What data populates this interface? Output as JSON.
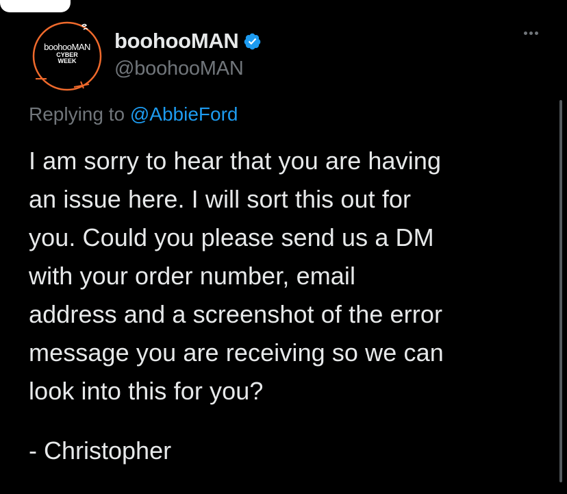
{
  "tweet": {
    "avatar": {
      "brand": "boohooMAN",
      "tagline_line1": "CYBER",
      "tagline_line2": "WEEK",
      "ring_color": "#f06a2c"
    },
    "display_name": "boohooMAN",
    "verified_icon": "verified-badge-icon",
    "handle": "@boohooMAN",
    "reply_prefix": "Replying to",
    "reply_mention": "@AbbieFord",
    "body": "I am sorry to hear that you are having\nan issue here. I will sort this out for\nyou. Could you please send us a DM\nwith your order number, email\naddress and a screenshot of the error\nmessage you are receiving so we can\nlook into this for you?",
    "signature": "- Christopher"
  },
  "colors": {
    "background": "#000000",
    "text": "#e7e9ea",
    "muted": "#71767b",
    "link": "#1d9bf0",
    "verified": "#1d9bf0"
  }
}
